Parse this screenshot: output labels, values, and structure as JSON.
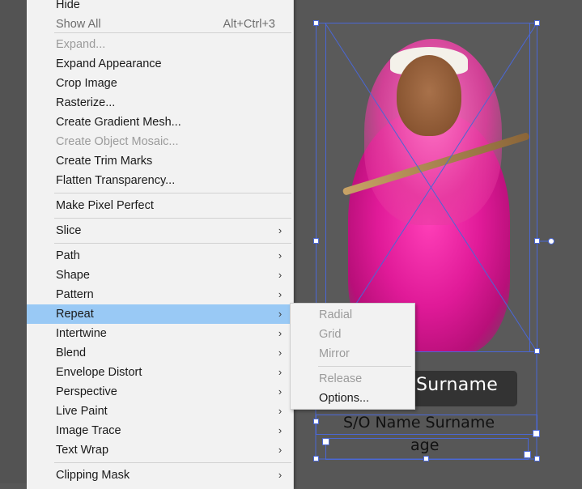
{
  "menu": {
    "items": [
      {
        "label": "Hide",
        "arrow": "›"
      },
      {
        "label": "Show All",
        "shortcut": "Alt+Ctrl+3"
      },
      {
        "label": "Expand..."
      },
      {
        "label": "Expand Appearance"
      },
      {
        "label": "Crop Image"
      },
      {
        "label": "Rasterize..."
      },
      {
        "label": "Create Gradient Mesh..."
      },
      {
        "label": "Create Object Mosaic..."
      },
      {
        "label": "Create Trim Marks"
      },
      {
        "label": "Flatten Transparency..."
      },
      {
        "label": "Make Pixel Perfect"
      },
      {
        "label": "Slice",
        "arrow": "›"
      },
      {
        "label": "Path",
        "arrow": "›"
      },
      {
        "label": "Shape",
        "arrow": "›"
      },
      {
        "label": "Pattern",
        "arrow": "›"
      },
      {
        "label": "Repeat",
        "arrow": "›"
      },
      {
        "label": "Intertwine",
        "arrow": "›"
      },
      {
        "label": "Blend",
        "arrow": "›"
      },
      {
        "label": "Envelope Distort",
        "arrow": "›"
      },
      {
        "label": "Perspective",
        "arrow": "›"
      },
      {
        "label": "Live Paint",
        "arrow": "›"
      },
      {
        "label": "Image Trace",
        "arrow": "›"
      },
      {
        "label": "Text Wrap",
        "arrow": "›"
      },
      {
        "label": "Clipping Mask",
        "arrow": "›"
      }
    ]
  },
  "submenu": {
    "items": [
      {
        "label": "Radial"
      },
      {
        "label": "Grid"
      },
      {
        "label": "Mirror"
      },
      {
        "label": "Release"
      },
      {
        "label": "Options..."
      }
    ]
  },
  "canvas": {
    "name_plate": "Surname",
    "so_line": "S/O Name Surname",
    "age_line": "age"
  },
  "colors": {
    "canvas_bg": "#575757",
    "menu_bg": "#f2f2f2",
    "highlight": "#99c9f5",
    "selection": "#4a67d6"
  }
}
